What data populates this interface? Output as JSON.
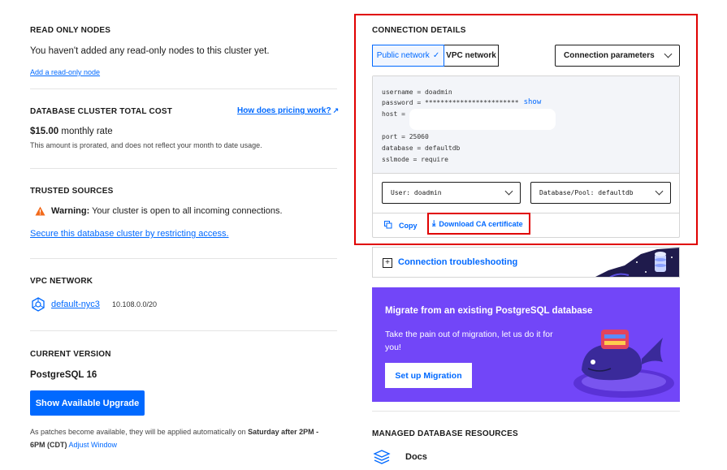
{
  "read_only": {
    "title": "READ ONLY NODES",
    "text": "You haven't added any read-only nodes to this cluster yet.",
    "link": "Add a read-only node"
  },
  "cost": {
    "title": "DATABASE CLUSTER TOTAL COST",
    "pricing_link": "How does pricing work?",
    "price": "$15.00",
    "rate_suffix": " monthly rate",
    "note": "This amount is prorated, and does not reflect your month to date usage."
  },
  "trusted": {
    "title": "TRUSTED SOURCES",
    "warning_bold": "Warning:",
    "warning_text": " Your cluster is open to all incoming connections.",
    "link": "Secure this database cluster by restricting access."
  },
  "vpc": {
    "title": "VPC NETWORK",
    "name": "default-nyc3",
    "cidr": "10.108.0.0/20"
  },
  "version": {
    "title": "CURRENT VERSION",
    "value": "PostgreSQL 16",
    "upgrade_button": "Show Available Upgrade",
    "note_a": "As patches become available, they will be applied automatically on ",
    "note_bold": "Saturday after 2PM - 6PM (CDT)",
    "adjust_link": "Adjust Window"
  },
  "connection": {
    "title": "CONNECTION DETAILS",
    "tabs": [
      {
        "label": "Public network",
        "selected": true
      },
      {
        "label": "VPC network",
        "selected": false
      }
    ],
    "params_select": "Connection parameters",
    "lines": {
      "username": "username = doadmin",
      "password": "password = ************************",
      "show": "show",
      "host": "host =",
      "port": "port = 25060",
      "database": "database = defaultdb",
      "sslmode": "sslmode = require"
    },
    "user_select": "User: doadmin",
    "db_select": "Database/Pool: defaultdb",
    "copy": "Copy",
    "download": "Download CA certificate",
    "highlight_color": "#e00000"
  },
  "troubleshoot": {
    "label": "Connection troubleshooting"
  },
  "migrate": {
    "title": "Migrate from an existing PostgreSQL database",
    "text": "Take the pain out of migration, let us do it for you!",
    "button": "Set up Migration",
    "bg": "#7246f8"
  },
  "resources": {
    "title": "MANAGED DATABASE RESOURCES",
    "docs": "Docs"
  }
}
